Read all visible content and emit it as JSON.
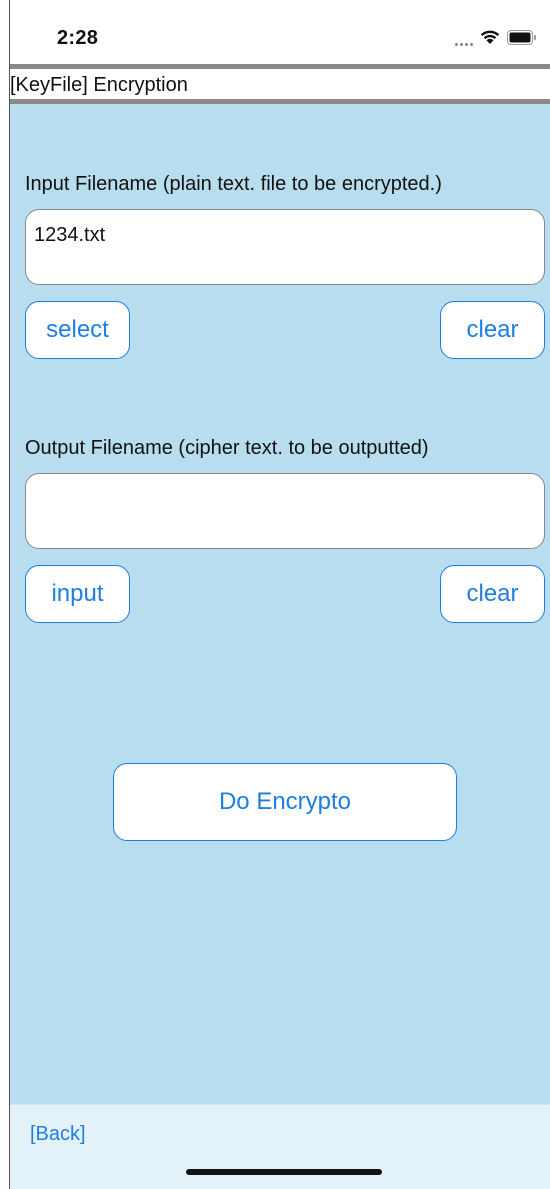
{
  "status_bar": {
    "time": "2:28",
    "icons": [
      "signal-dots-icon",
      "wifi-icon",
      "battery-icon"
    ]
  },
  "title_bar": {
    "title": "[KeyFile] Encryption"
  },
  "input_section": {
    "label": "Input Filename (plain text. file to be encrypted.)",
    "value": "1234.txt",
    "select_label": "select",
    "clear_label": "clear"
  },
  "output_section": {
    "label": "Output Filename (cipher text. to be outputted)",
    "value": "",
    "input_label": "input",
    "clear_label": "clear"
  },
  "action": {
    "encrypt_label": "Do Encrypto"
  },
  "bottom_bar": {
    "back_label": "[Back]"
  },
  "colors": {
    "background": "#b8ddef",
    "accent": "#1d7fe0",
    "bottom_bar": "#e3f2f9",
    "title_border": "#8a8a8a"
  }
}
